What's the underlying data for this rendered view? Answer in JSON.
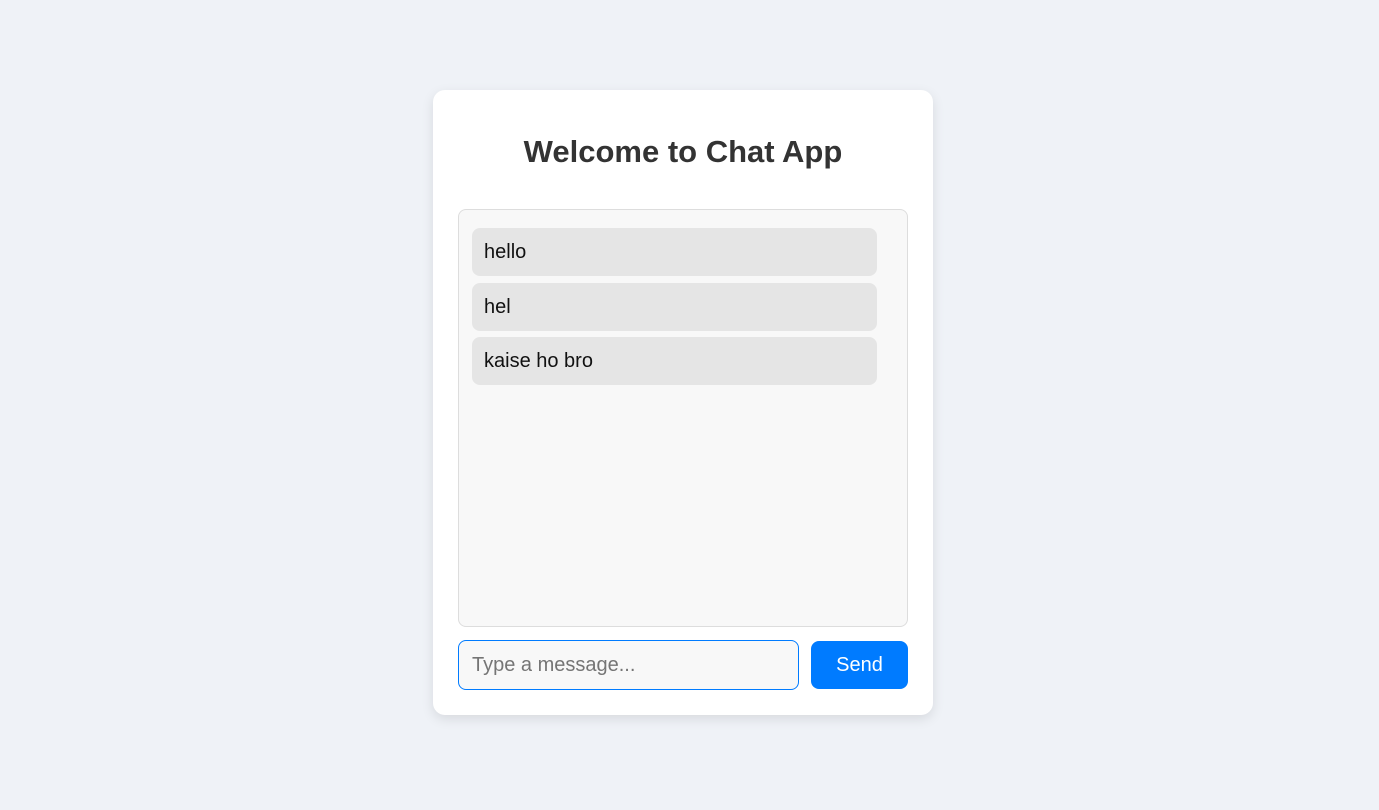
{
  "app": {
    "title": "Welcome to Chat App"
  },
  "chat": {
    "messages": [
      {
        "text": "hello"
      },
      {
        "text": "hel"
      },
      {
        "text": "kaise ho bro"
      }
    ]
  },
  "composer": {
    "placeholder": "Type a message...",
    "value": "",
    "send_label": "Send"
  },
  "colors": {
    "background": "#eff2f7",
    "accent": "#007bff",
    "message_bubble": "#e5e5e5"
  }
}
